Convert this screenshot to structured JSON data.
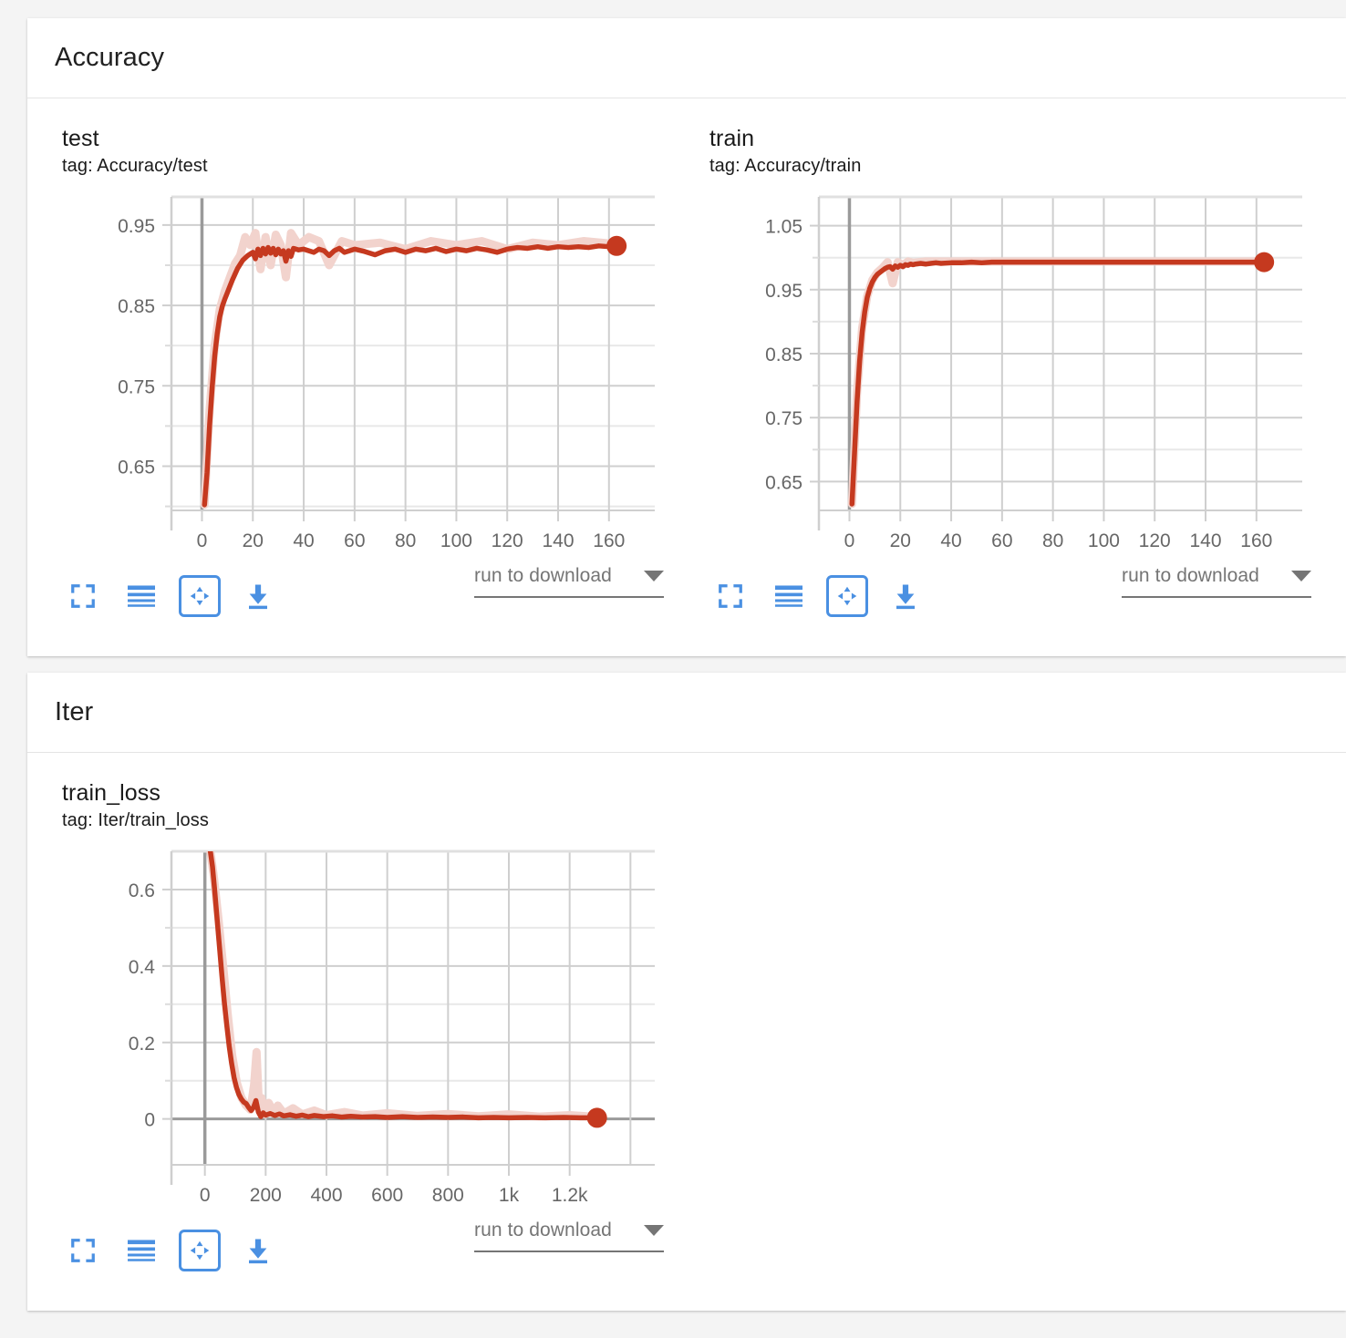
{
  "page": {
    "background": "#f4f4f4",
    "accent_blue": "#4a90e2",
    "series_color": "#c5391f",
    "series_faded_color": "#f2d3cd"
  },
  "sections": [
    {
      "title": "Accuracy",
      "charts": [
        {
          "title": "test",
          "tag": "tag: Accuracy/test",
          "toolbar": {
            "fullscreen_label": "expand-icon",
            "lines_label": "data-table-icon",
            "fit_label": "fit-domain-icon",
            "download_label": "download-icon",
            "select_value": "run to download"
          }
        },
        {
          "title": "train",
          "tag": "tag: Accuracy/train",
          "toolbar": {
            "fullscreen_label": "expand-icon",
            "lines_label": "data-table-icon",
            "fit_label": "fit-domain-icon",
            "download_label": "download-icon",
            "select_value": "run to download"
          }
        }
      ]
    },
    {
      "title": "Iter",
      "charts": [
        {
          "title": "train_loss",
          "tag": "tag: Iter/train_loss",
          "toolbar": {
            "fullscreen_label": "expand-icon",
            "lines_label": "data-table-icon",
            "fit_label": "fit-domain-icon",
            "download_label": "download-icon",
            "select_value": "run to download"
          }
        }
      ]
    }
  ],
  "chart_data": [
    {
      "type": "line",
      "title": "test",
      "tag": "Accuracy/test",
      "xlabel": "",
      "ylabel": "",
      "xlim": [
        -12,
        178
      ],
      "ylim": [
        0.595,
        0.985
      ],
      "xticks": [
        0,
        20,
        40,
        60,
        80,
        100,
        120,
        140,
        160
      ],
      "yticks": [
        0.65,
        0.75,
        0.85,
        0.95
      ],
      "yminor": [
        0.6,
        0.7,
        0.8,
        0.9
      ],
      "grid": true,
      "legend": "none",
      "endpoint_marker": true,
      "series": [
        {
          "name": "Accuracy/test (smoothed)",
          "x": [
            1,
            2,
            3,
            4,
            5,
            6,
            7,
            8,
            9,
            10,
            11,
            12,
            13,
            14,
            15,
            16,
            17,
            18,
            19,
            20,
            21,
            22,
            23,
            24,
            25,
            26,
            27,
            28,
            29,
            30,
            31,
            32,
            33,
            34,
            35,
            36,
            38,
            40,
            42,
            44,
            46,
            48,
            50,
            52,
            54,
            56,
            58,
            60,
            64,
            68,
            72,
            76,
            80,
            84,
            88,
            92,
            96,
            100,
            104,
            108,
            112,
            116,
            120,
            124,
            128,
            132,
            136,
            140,
            144,
            148,
            152,
            156,
            160,
            163
          ],
          "y": [
            0.602,
            0.642,
            0.701,
            0.748,
            0.787,
            0.815,
            0.836,
            0.849,
            0.858,
            0.866,
            0.874,
            0.882,
            0.889,
            0.896,
            0.901,
            0.906,
            0.909,
            0.912,
            0.914,
            0.916,
            0.908,
            0.92,
            0.912,
            0.921,
            0.914,
            0.922,
            0.915,
            0.921,
            0.913,
            0.92,
            0.914,
            0.918,
            0.905,
            0.918,
            0.911,
            0.921,
            0.919,
            0.92,
            0.918,
            0.916,
            0.92,
            0.918,
            0.912,
            0.918,
            0.921,
            0.916,
            0.918,
            0.92,
            0.917,
            0.913,
            0.918,
            0.92,
            0.916,
            0.92,
            0.918,
            0.921,
            0.917,
            0.92,
            0.918,
            0.921,
            0.919,
            0.916,
            0.92,
            0.922,
            0.921,
            0.923,
            0.921,
            0.923,
            0.922,
            0.923,
            0.922,
            0.924,
            0.923,
            0.924
          ]
        },
        {
          "name": "Accuracy/test (raw)",
          "x": [
            1,
            3,
            5,
            7,
            9,
            11,
            13,
            15,
            17,
            19,
            21,
            23,
            25,
            27,
            29,
            31,
            33,
            35,
            38,
            42,
            46,
            50,
            55,
            60,
            70,
            80,
            90,
            100,
            110,
            120,
            130,
            140,
            150,
            160,
            163
          ],
          "y": [
            0.602,
            0.72,
            0.8,
            0.845,
            0.868,
            0.885,
            0.902,
            0.912,
            0.935,
            0.925,
            0.94,
            0.895,
            0.935,
            0.9,
            0.938,
            0.925,
            0.885,
            0.94,
            0.925,
            0.935,
            0.93,
            0.9,
            0.93,
            0.925,
            0.928,
            0.92,
            0.93,
            0.925,
            0.93,
            0.92,
            0.928,
            0.925,
            0.93,
            0.927,
            0.924
          ]
        }
      ]
    },
    {
      "type": "line",
      "title": "train",
      "tag": "Accuracy/train",
      "xlabel": "",
      "ylabel": "",
      "xlim": [
        -12,
        178
      ],
      "ylim": [
        0.605,
        1.095
      ],
      "xticks": [
        0,
        20,
        40,
        60,
        80,
        100,
        120,
        140,
        160
      ],
      "yticks": [
        0.65,
        0.75,
        0.85,
        0.95,
        1.05
      ],
      "yminor": [
        0.7,
        0.8,
        0.9,
        1.0
      ],
      "grid": true,
      "legend": "none",
      "endpoint_marker": true,
      "series": [
        {
          "name": "Accuracy/train (smoothed)",
          "x": [
            1,
            2,
            3,
            4,
            5,
            6,
            7,
            8,
            9,
            10,
            11,
            12,
            13,
            14,
            15,
            16,
            17,
            18,
            19,
            20,
            21,
            22,
            23,
            24,
            25,
            26,
            28,
            30,
            32,
            34,
            36,
            40,
            44,
            48,
            52,
            56,
            60,
            70,
            80,
            90,
            100,
            110,
            120,
            130,
            140,
            150,
            160,
            163
          ],
          "y": [
            0.615,
            0.695,
            0.775,
            0.838,
            0.883,
            0.915,
            0.938,
            0.952,
            0.962,
            0.969,
            0.974,
            0.977,
            0.98,
            0.983,
            0.985,
            0.986,
            0.982,
            0.987,
            0.985,
            0.988,
            0.986,
            0.989,
            0.988,
            0.99,
            0.989,
            0.99,
            0.991,
            0.99,
            0.991,
            0.992,
            0.991,
            0.992,
            0.992,
            0.993,
            0.992,
            0.993,
            0.993,
            0.993,
            0.993,
            0.993,
            0.993,
            0.993,
            0.993,
            0.993,
            0.993,
            0.993,
            0.993,
            0.993
          ]
        },
        {
          "name": "Accuracy/train (raw)",
          "x": [
            1,
            3,
            5,
            7,
            9,
            11,
            13,
            15,
            17,
            19,
            21,
            23,
            25,
            30,
            40,
            60,
            80,
            100,
            120,
            140,
            160,
            163
          ],
          "y": [
            0.615,
            0.79,
            0.89,
            0.94,
            0.965,
            0.977,
            0.984,
            0.993,
            0.96,
            0.993,
            0.988,
            0.994,
            0.992,
            0.994,
            0.994,
            0.994,
            0.994,
            0.994,
            0.994,
            0.994,
            0.994,
            0.993
          ]
        }
      ]
    },
    {
      "type": "line",
      "title": "train_loss",
      "tag": "Iter/train_loss",
      "xlabel": "",
      "ylabel": "",
      "xlim": [
        -110,
        1480
      ],
      "ylim": [
        -0.12,
        0.7
      ],
      "xticks": [
        0,
        200,
        400,
        600,
        800,
        1000,
        1200
      ],
      "xticklabels": [
        "0",
        "200",
        "400",
        "600",
        "800",
        "1k",
        "1.2k"
      ],
      "yticks": [
        0,
        0.2,
        0.4,
        0.6
      ],
      "yminor": [
        0.1,
        0.3,
        0.5
      ],
      "grid": true,
      "legend": "none",
      "endpoint_marker": true,
      "series": [
        {
          "name": "Iter/train_loss (smoothed)",
          "x": [
            18,
            25,
            32,
            40,
            48,
            56,
            64,
            72,
            80,
            88,
            96,
            104,
            112,
            120,
            128,
            136,
            144,
            152,
            160,
            168,
            176,
            184,
            192,
            200,
            215,
            230,
            245,
            260,
            280,
            300,
            320,
            340,
            360,
            390,
            420,
            450,
            480,
            520,
            560,
            600,
            650,
            700,
            750,
            800,
            850,
            900,
            950,
            1000,
            1060,
            1120,
            1180,
            1240,
            1290
          ],
          "y": [
            0.7,
            0.66,
            0.6,
            0.525,
            0.45,
            0.375,
            0.305,
            0.245,
            0.19,
            0.145,
            0.108,
            0.082,
            0.064,
            0.052,
            0.044,
            0.04,
            0.03,
            0.022,
            0.03,
            0.048,
            0.018,
            0.006,
            0.016,
            0.01,
            0.014,
            0.009,
            0.013,
            0.008,
            0.011,
            0.007,
            0.01,
            0.006,
            0.009,
            0.006,
            0.008,
            0.005,
            0.007,
            0.005,
            0.006,
            0.004,
            0.006,
            0.004,
            0.005,
            0.004,
            0.005,
            0.003,
            0.004,
            0.003,
            0.004,
            0.003,
            0.004,
            0.003,
            0.003
          ]
        },
        {
          "name": "Iter/train_loss (raw)",
          "x": [
            18,
            30,
            45,
            60,
            75,
            90,
            105,
            120,
            135,
            150,
            162,
            170,
            178,
            186,
            196,
            210,
            225,
            240,
            260,
            290,
            320,
            360,
            400,
            460,
            520,
            600,
            700,
            800,
            900,
            1000,
            1100,
            1200,
            1290
          ],
          "y": [
            0.7,
            0.63,
            0.52,
            0.4,
            0.275,
            0.165,
            0.095,
            0.056,
            0.036,
            0.024,
            0.09,
            0.175,
            0.03,
            0.055,
            0.012,
            0.042,
            0.018,
            0.035,
            0.014,
            0.028,
            0.012,
            0.022,
            0.01,
            0.018,
            0.009,
            0.015,
            0.008,
            0.013,
            0.007,
            0.012,
            0.006,
            0.01,
            0.005
          ]
        }
      ]
    }
  ]
}
